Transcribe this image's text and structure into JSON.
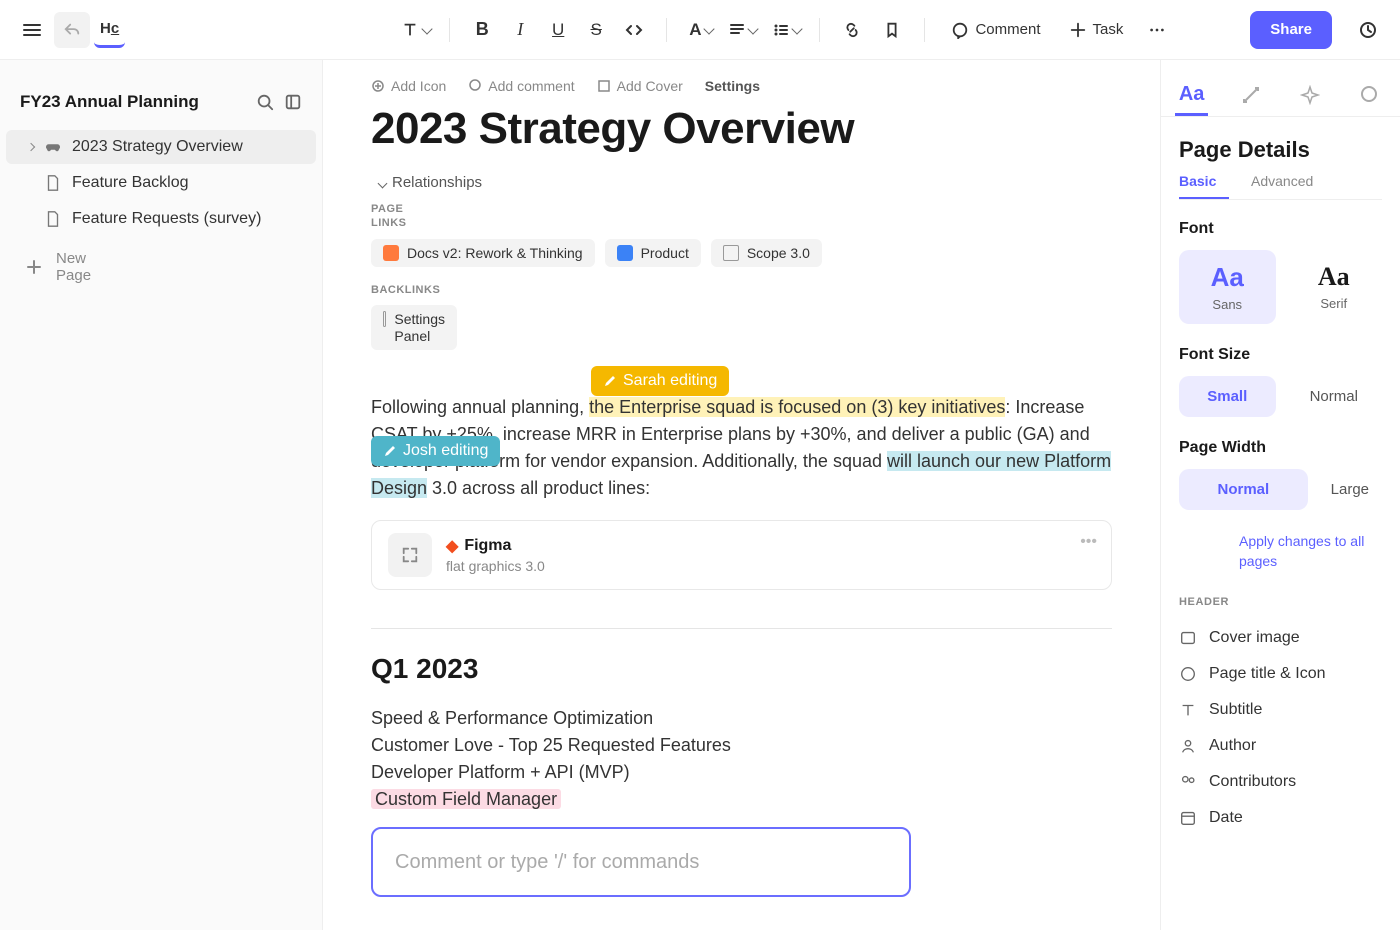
{
  "toolbar": {
    "comment": "Comment",
    "task": "Task",
    "share": "Share"
  },
  "sidebar": {
    "title": "FY23 Annual Planning",
    "items": [
      "2023 Strategy Overview",
      "Feature Backlog",
      "Feature Requests (survey)"
    ],
    "new_page": "New Page"
  },
  "doc": {
    "actions": {
      "add_icon": "Add Icon",
      "add_comment": "Add comment",
      "add_cover": "Add Cover",
      "settings": "Settings"
    },
    "title": "2023 Strategy Overview",
    "relationships_label": "Relationships",
    "page_links_label": "PAGE LINKS",
    "page_links": [
      "Docs v2: Rework & Thinking",
      "Product",
      "Scope 3.0"
    ],
    "backlinks_label": "BACKLINKS",
    "backlinks": [
      "Settings Panel"
    ],
    "presence": {
      "sarah": "Sarah editing",
      "josh": "Josh editing"
    },
    "body_p1_a": "Following annual planning, ",
    "body_p1_b": "the Enterprise squad is focused on (3) key initiatives",
    "body_p1_c": ": Increase CSAT by +25%, increase MRR in Enterprise plans by +30%, and deliver a ",
    "body_p1_d": "public (GA)",
    "body_p1_e": " and developer platform for vendor expansion. Additionally, the squad ",
    "body_p1_f": "will launch our new Platform Design",
    "body_p1_g": " 3.0 across all product lines:",
    "figma": {
      "title": "Figma",
      "subtitle": "flat graphics 3.0"
    },
    "q1_heading": "Q1 2023",
    "q1_items": [
      "Speed & Performance Optimization",
      "Customer Love - Top 25 Requested Features",
      "Developer Platform + API (MVP)",
      "Custom Field Manager"
    ],
    "comment_placeholder": "Comment or type '/' for commands"
  },
  "panel": {
    "heading": "Page Details",
    "tabs": {
      "basic": "Basic",
      "advanced": "Advanced"
    },
    "font": {
      "label": "Font",
      "sans": "Sans",
      "serif": "Serif"
    },
    "font_size": {
      "label": "Font Size",
      "small": "Small",
      "normal": "Normal"
    },
    "page_width": {
      "label": "Page Width",
      "normal": "Normal",
      "large": "Large"
    },
    "apply_all": "Apply changes to all pages",
    "header_label": "HEADER",
    "header_items": [
      "Cover image",
      "Page title & Icon",
      "Subtitle",
      "Author",
      "Contributors",
      "Date"
    ]
  }
}
